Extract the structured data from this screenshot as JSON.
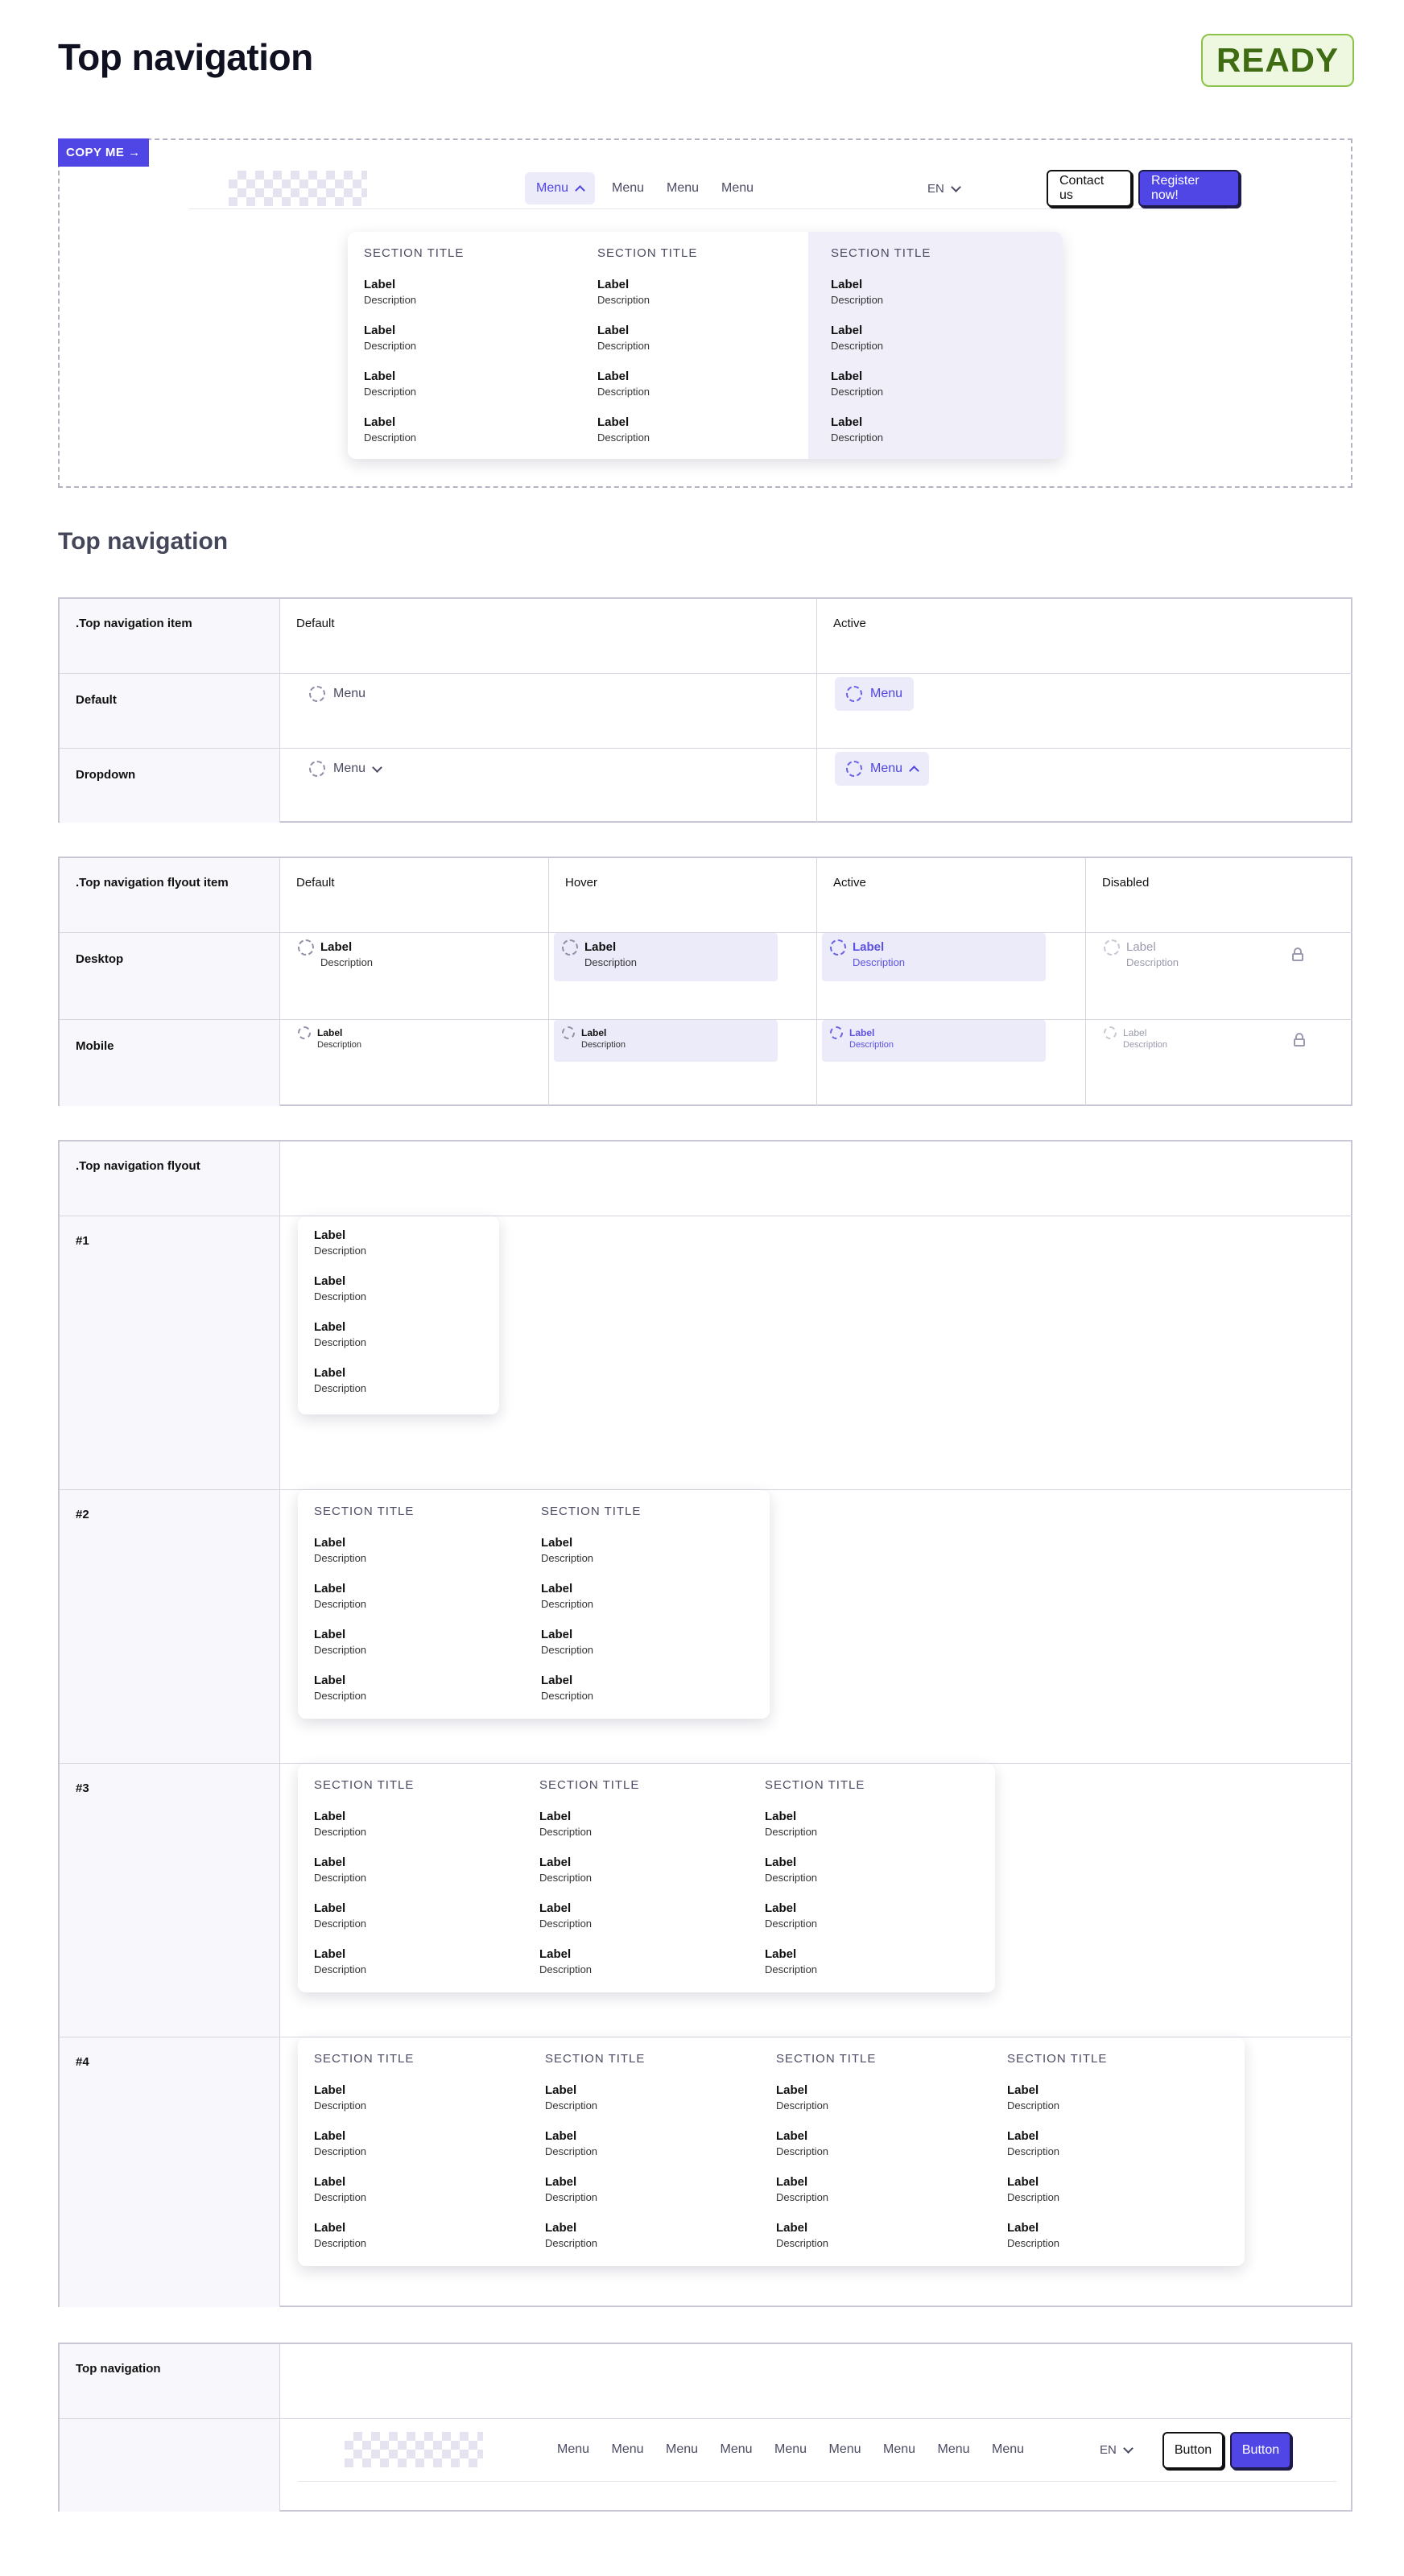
{
  "page": {
    "title": "Top navigation",
    "status": "READY",
    "section_heading": "Top navigation"
  },
  "copy_me": {
    "label": "COPY ME →"
  },
  "navbar": {
    "menus": [
      "Menu",
      "Menu",
      "Menu",
      "Menu"
    ],
    "lang": "EN",
    "contact": "Contact us",
    "register": "Register now!"
  },
  "flyout_common": {
    "section_title": "SECTION TITLE",
    "label": "Label",
    "description": "Description"
  },
  "table_item": {
    "header": ".Top navigation item",
    "columns": [
      "Default",
      "Active"
    ],
    "rows": [
      "Default",
      "Dropdown"
    ],
    "menu_label": "Menu"
  },
  "table_flyout_item": {
    "header": ".Top navigation flyout item",
    "columns": [
      "Default",
      "Hover",
      "Active",
      "Disabled"
    ],
    "rows": [
      "Desktop",
      "Mobile"
    ],
    "label": "Label",
    "description": "Description"
  },
  "table_flyout": {
    "header": ".Top navigation flyout",
    "rows": [
      "#1",
      "#2",
      "#3",
      "#4"
    ]
  },
  "table_topnav": {
    "header": "Top navigation",
    "menus": [
      "Menu",
      "Menu",
      "Menu",
      "Menu",
      "Menu",
      "Menu",
      "Menu",
      "Menu",
      "Menu"
    ],
    "lang": "EN",
    "button_secondary": "Button",
    "button_primary": "Button"
  }
}
